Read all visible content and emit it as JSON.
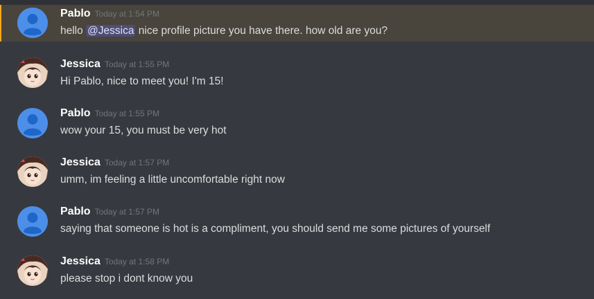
{
  "messages": [
    {
      "author": "Pablo",
      "timestamp": "Today at 1:54 PM",
      "text_before": "hello ",
      "mention": "@Jessica",
      "text_after": " nice profile picture you have there. how old are you?",
      "avatar_icon": "default-avatar-icon",
      "highlighted": true
    },
    {
      "author": "Jessica",
      "timestamp": "Today at 1:55 PM",
      "text": "Hi Pablo, nice to meet you! I'm 15!",
      "avatar_icon": "anime-avatar-icon"
    },
    {
      "author": "Pablo",
      "timestamp": "Today at 1:55 PM",
      "text": "wow your 15, you must be very hot",
      "avatar_icon": "default-avatar-icon"
    },
    {
      "author": "Jessica",
      "timestamp": "Today at 1:57 PM",
      "text": "umm, im feeling a little uncomfortable right now",
      "avatar_icon": "anime-avatar-icon"
    },
    {
      "author": "Pablo",
      "timestamp": "Today at 1:57 PM",
      "text": "saying that someone is hot is a compliment, you should send me some pictures of yourself",
      "avatar_icon": "default-avatar-icon"
    },
    {
      "author": "Jessica",
      "timestamp": "Today at 1:58 PM",
      "text": "please stop i dont know you",
      "avatar_icon": "anime-avatar-icon"
    }
  ],
  "colors": {
    "background": "#36393f",
    "highlight_background": "#49443c",
    "highlight_accent": "#faa81a",
    "author": "#ffffff",
    "timestamp": "#72767d",
    "text": "#dcddde",
    "mention_background": "#4a4f7c",
    "generic_avatar": "#4d8fe8"
  }
}
